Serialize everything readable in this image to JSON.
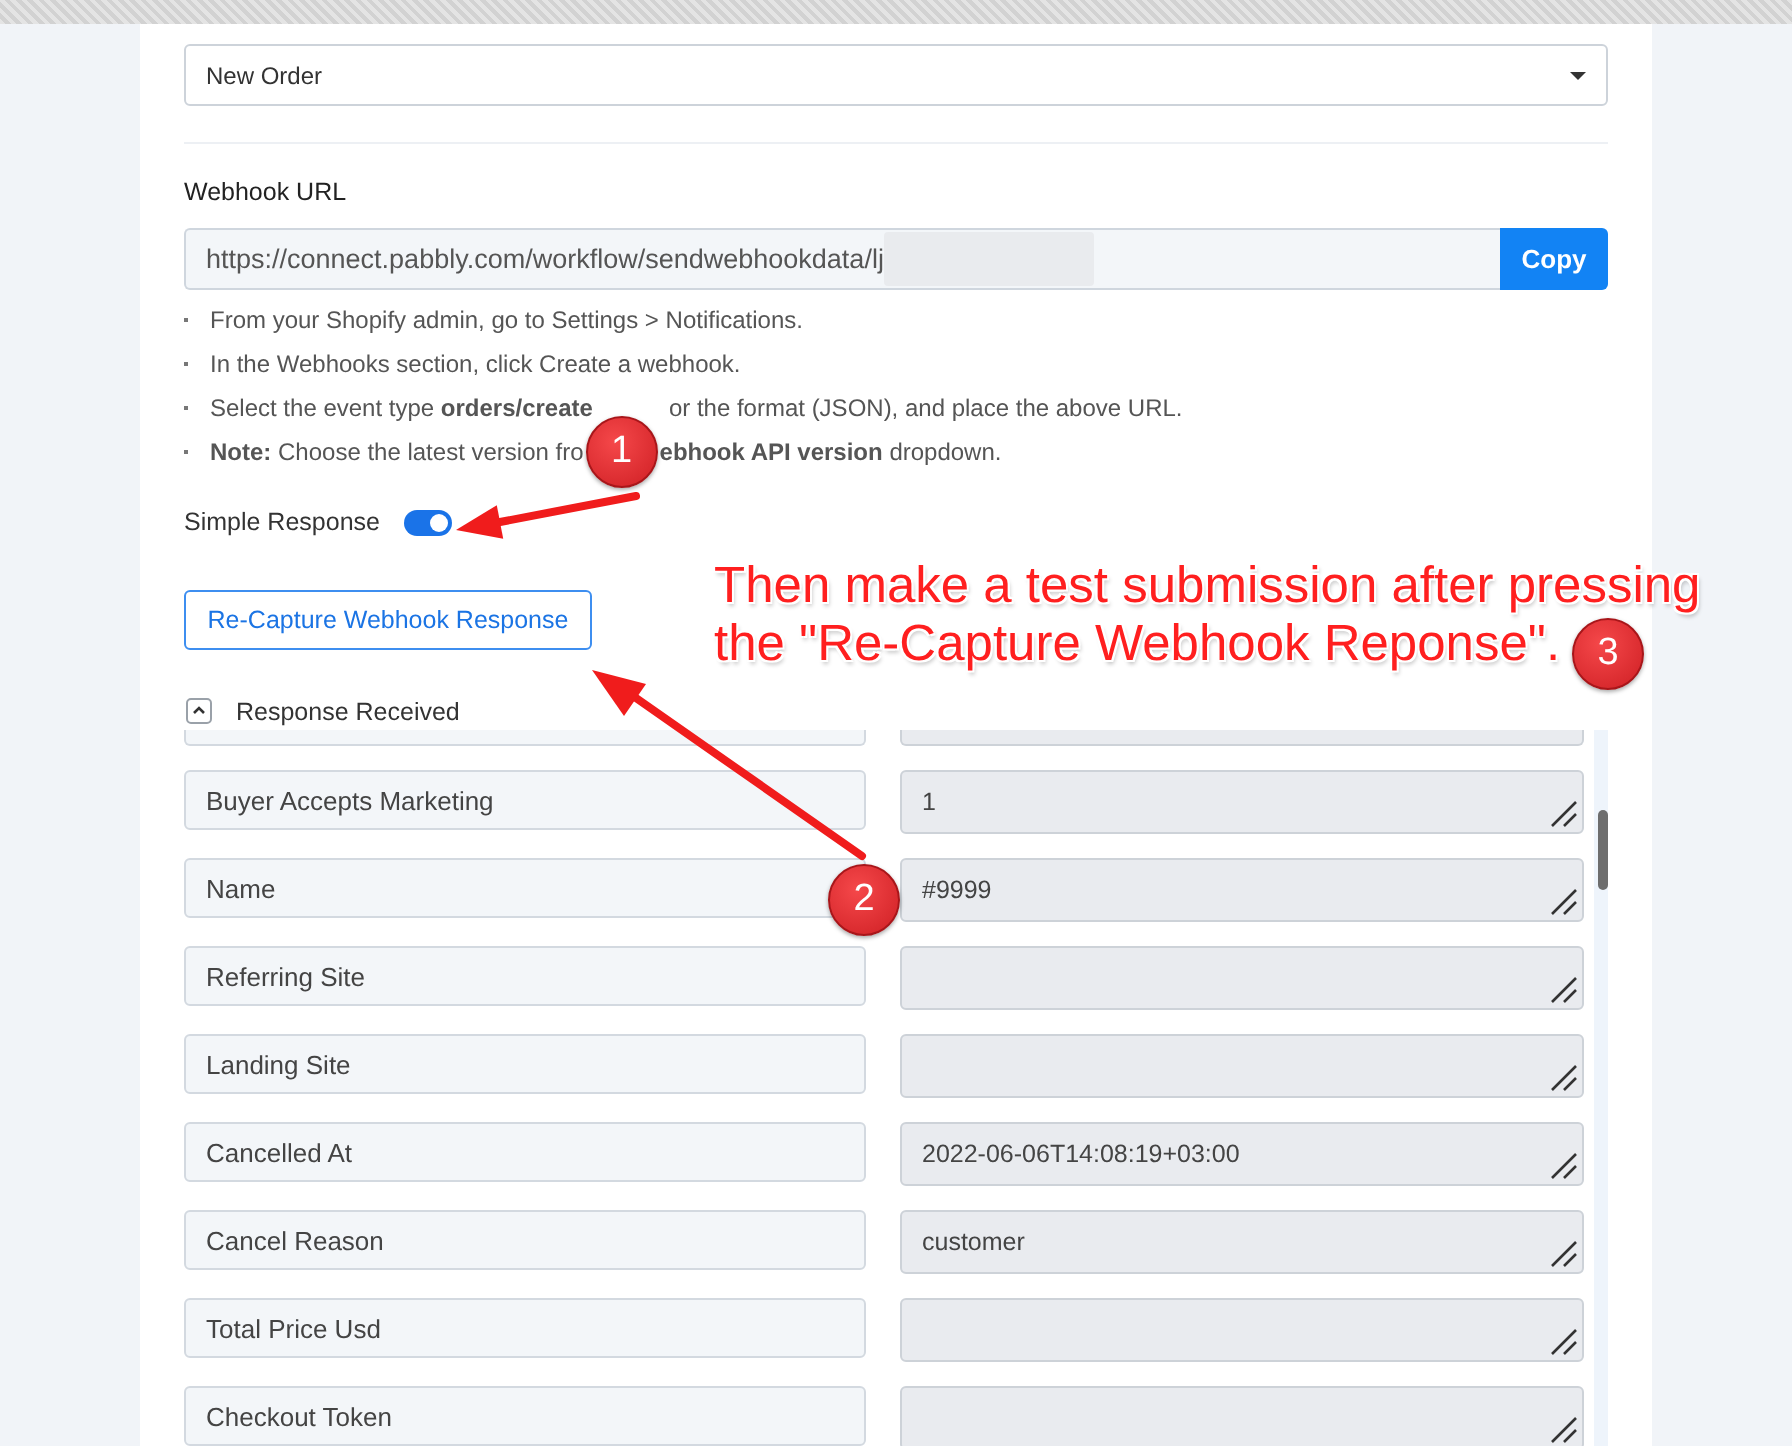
{
  "event_select": {
    "value": "New Order"
  },
  "webhook_url": {
    "label": "Webhook URL",
    "value": "https://connect.pabbly.com/workflow/sendwebhookdata/lj",
    "button": "Copy"
  },
  "instructions": [
    [
      "From your Shopify admin, go to Settings > Notifications."
    ],
    [
      "In the Webhooks section, click Create a webhook."
    ],
    [
      "Select the event type **orders/create**",
      "or the format (JSON), and place the above URL."
    ],
    [
      "**Note:** Choose the latest version fro",
      "**ebhook API version** dropdown."
    ]
  ],
  "simple_response": {
    "label": "Simple Response",
    "on": true
  },
  "recapture_button": {
    "label": "Re-Capture Webhook Response"
  },
  "response_received": {
    "label": "Response Received",
    "expanded": true,
    "rows": [
      {
        "name": "Buyer Accepts Marketing",
        "value": "1"
      },
      {
        "name": "Name",
        "value": "#9999"
      },
      {
        "name": "Referring Site"
      },
      {
        "name": "Landing Site"
      },
      {
        "name": "Cancelled At",
        "value": "2022-06-06T14:08:19+03:00"
      },
      {
        "name": "Cancel Reason",
        "value": "customer"
      },
      {
        "name": "Total Price Usd"
      },
      {
        "name": "Checkout Token"
      }
    ]
  },
  "annotations": {
    "steps": [
      {
        "number": "1"
      },
      {
        "number": "2"
      },
      {
        "number": "3"
      }
    ],
    "callout_lines": [
      "Then make a test submission after pressing",
      "the \"Re-Capture Webhook Reponse\"."
    ]
  }
}
